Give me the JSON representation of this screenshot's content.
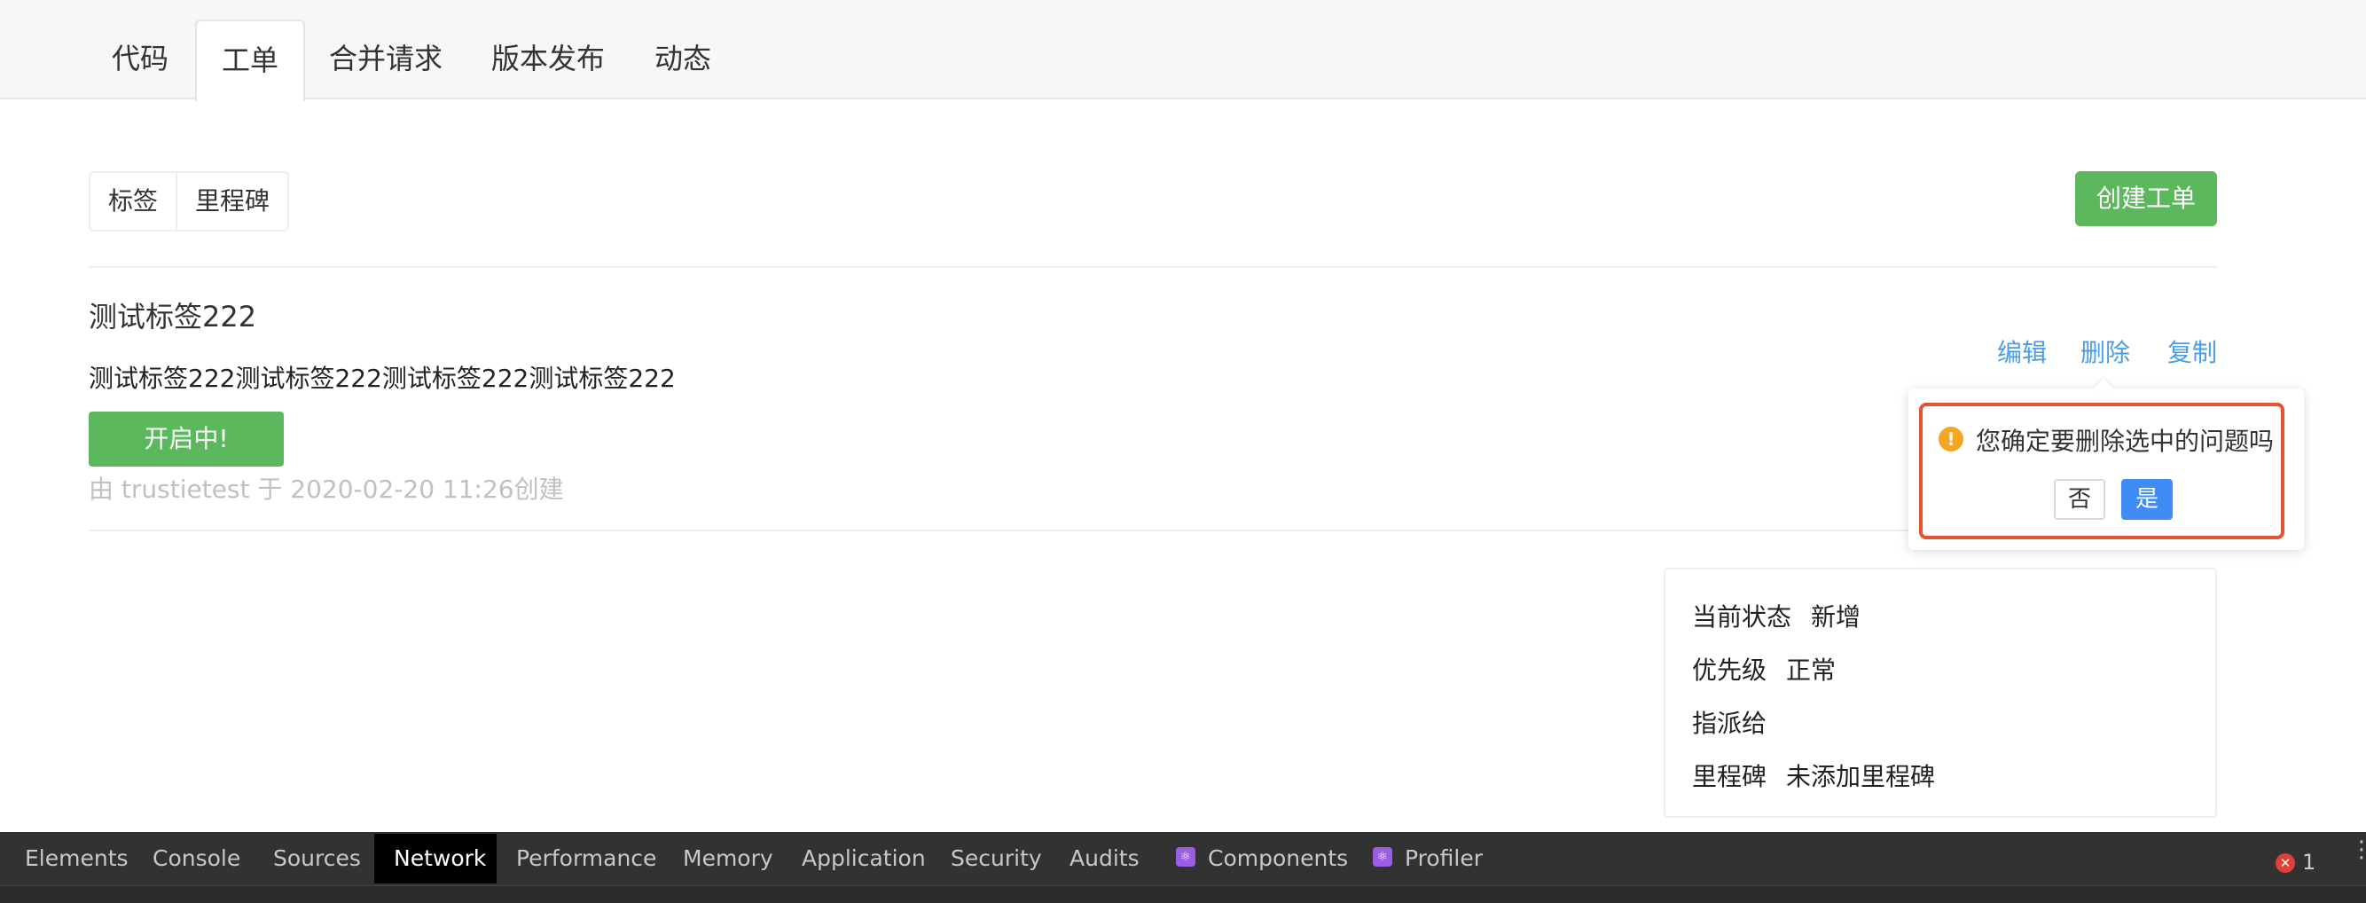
{
  "project_tabs": [
    {
      "label": "代码"
    },
    {
      "label": "工单"
    },
    {
      "label": "合并请求"
    },
    {
      "label": "版本发布"
    },
    {
      "label": "动态"
    }
  ],
  "active_tab_index": 1,
  "toolbar": {
    "labels_button": "标签",
    "milestones_button": "里程碑",
    "create_issue_button": "创建工单"
  },
  "issue": {
    "title": "测试标签222",
    "description": "测试标签222测试标签222测试标签222测试标签222",
    "status_button": "开启中!",
    "meta": "由 trustietest 于 2020-02-20 11:26创建",
    "actions": {
      "edit": "编辑",
      "delete": "删除",
      "copy": "复制"
    }
  },
  "confirm_popover": {
    "icon": "warning-icon",
    "message": "您确定要删除选中的问题吗",
    "no_label": "否",
    "yes_label": "是"
  },
  "issue_info": {
    "status_label": "当前状态",
    "status_value": "新增",
    "priority_label": "优先级",
    "priority_value": "正常",
    "assignee_label": "指派给",
    "milestone_label": "里程碑",
    "milestone_value": "未添加里程碑"
  },
  "devtools": {
    "tabs": [
      "Elements",
      "Console",
      "Sources",
      "Network",
      "Performance",
      "Memory",
      "Application",
      "Security",
      "Audits",
      "Components",
      "Profiler"
    ],
    "active_tab": "Network",
    "error_count": "1"
  },
  "colors": {
    "primary_green": "#5cb85c",
    "link_blue": "#4a9de6",
    "confirm_blue": "#3f8cf7",
    "warning_orange": "#f5a623",
    "highlight_frame": "#e2532f"
  }
}
